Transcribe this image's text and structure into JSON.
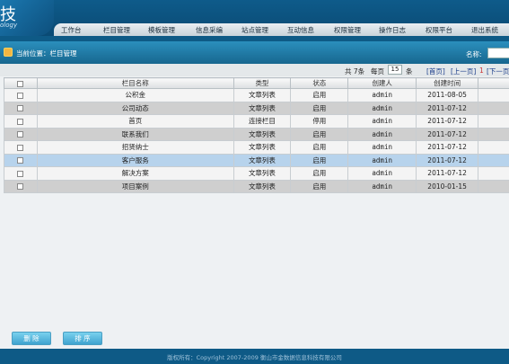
{
  "logo": {
    "big": "技",
    "small": "ology"
  },
  "nav": [
    "工作台",
    "栏目管理",
    "模板管理",
    "信息采编",
    "站点管理",
    "互动信息",
    "权限管理",
    "操作日志",
    "权限平台",
    "退出系统"
  ],
  "pathbar": {
    "text": "当前位置：栏目管理",
    "name_label": "名称:"
  },
  "pager": {
    "total": "共 7条",
    "per_page_label": "每页",
    "per_page": "15",
    "per_page_unit": "条",
    "first": "[首页]",
    "prev": "[上一页]",
    "current": "1",
    "next": "[下一页"
  },
  "table": {
    "headers": [
      "栏目名称",
      "类型",
      "状态",
      "创建人",
      "创建时间"
    ],
    "rows": [
      [
        "公积金",
        "文章列表",
        "启用",
        "admin",
        "2011-08-05"
      ],
      [
        "公司动态",
        "文章列表",
        "启用",
        "admin",
        "2011-07-12"
      ],
      [
        "首页",
        "连接栏目",
        "停用",
        "admin",
        "2011-07-12"
      ],
      [
        "联系我们",
        "文章列表",
        "启用",
        "admin",
        "2011-07-12"
      ],
      [
        "招贤纳士",
        "文章列表",
        "启用",
        "admin",
        "2011-07-12"
      ],
      [
        "客户服务",
        "文章列表",
        "启用",
        "admin",
        "2011-07-12"
      ],
      [
        "解决方案",
        "文章列表",
        "启用",
        "admin",
        "2011-07-12"
      ],
      [
        "项目案例",
        "文章列表",
        "启用",
        "admin",
        "2010-01-15"
      ]
    ]
  },
  "buttons": {
    "delete": "删 除",
    "sort": "排 序"
  },
  "footer": "版权所有：Copyright 2007-2009 衡山市金数据信息科技有限公司"
}
